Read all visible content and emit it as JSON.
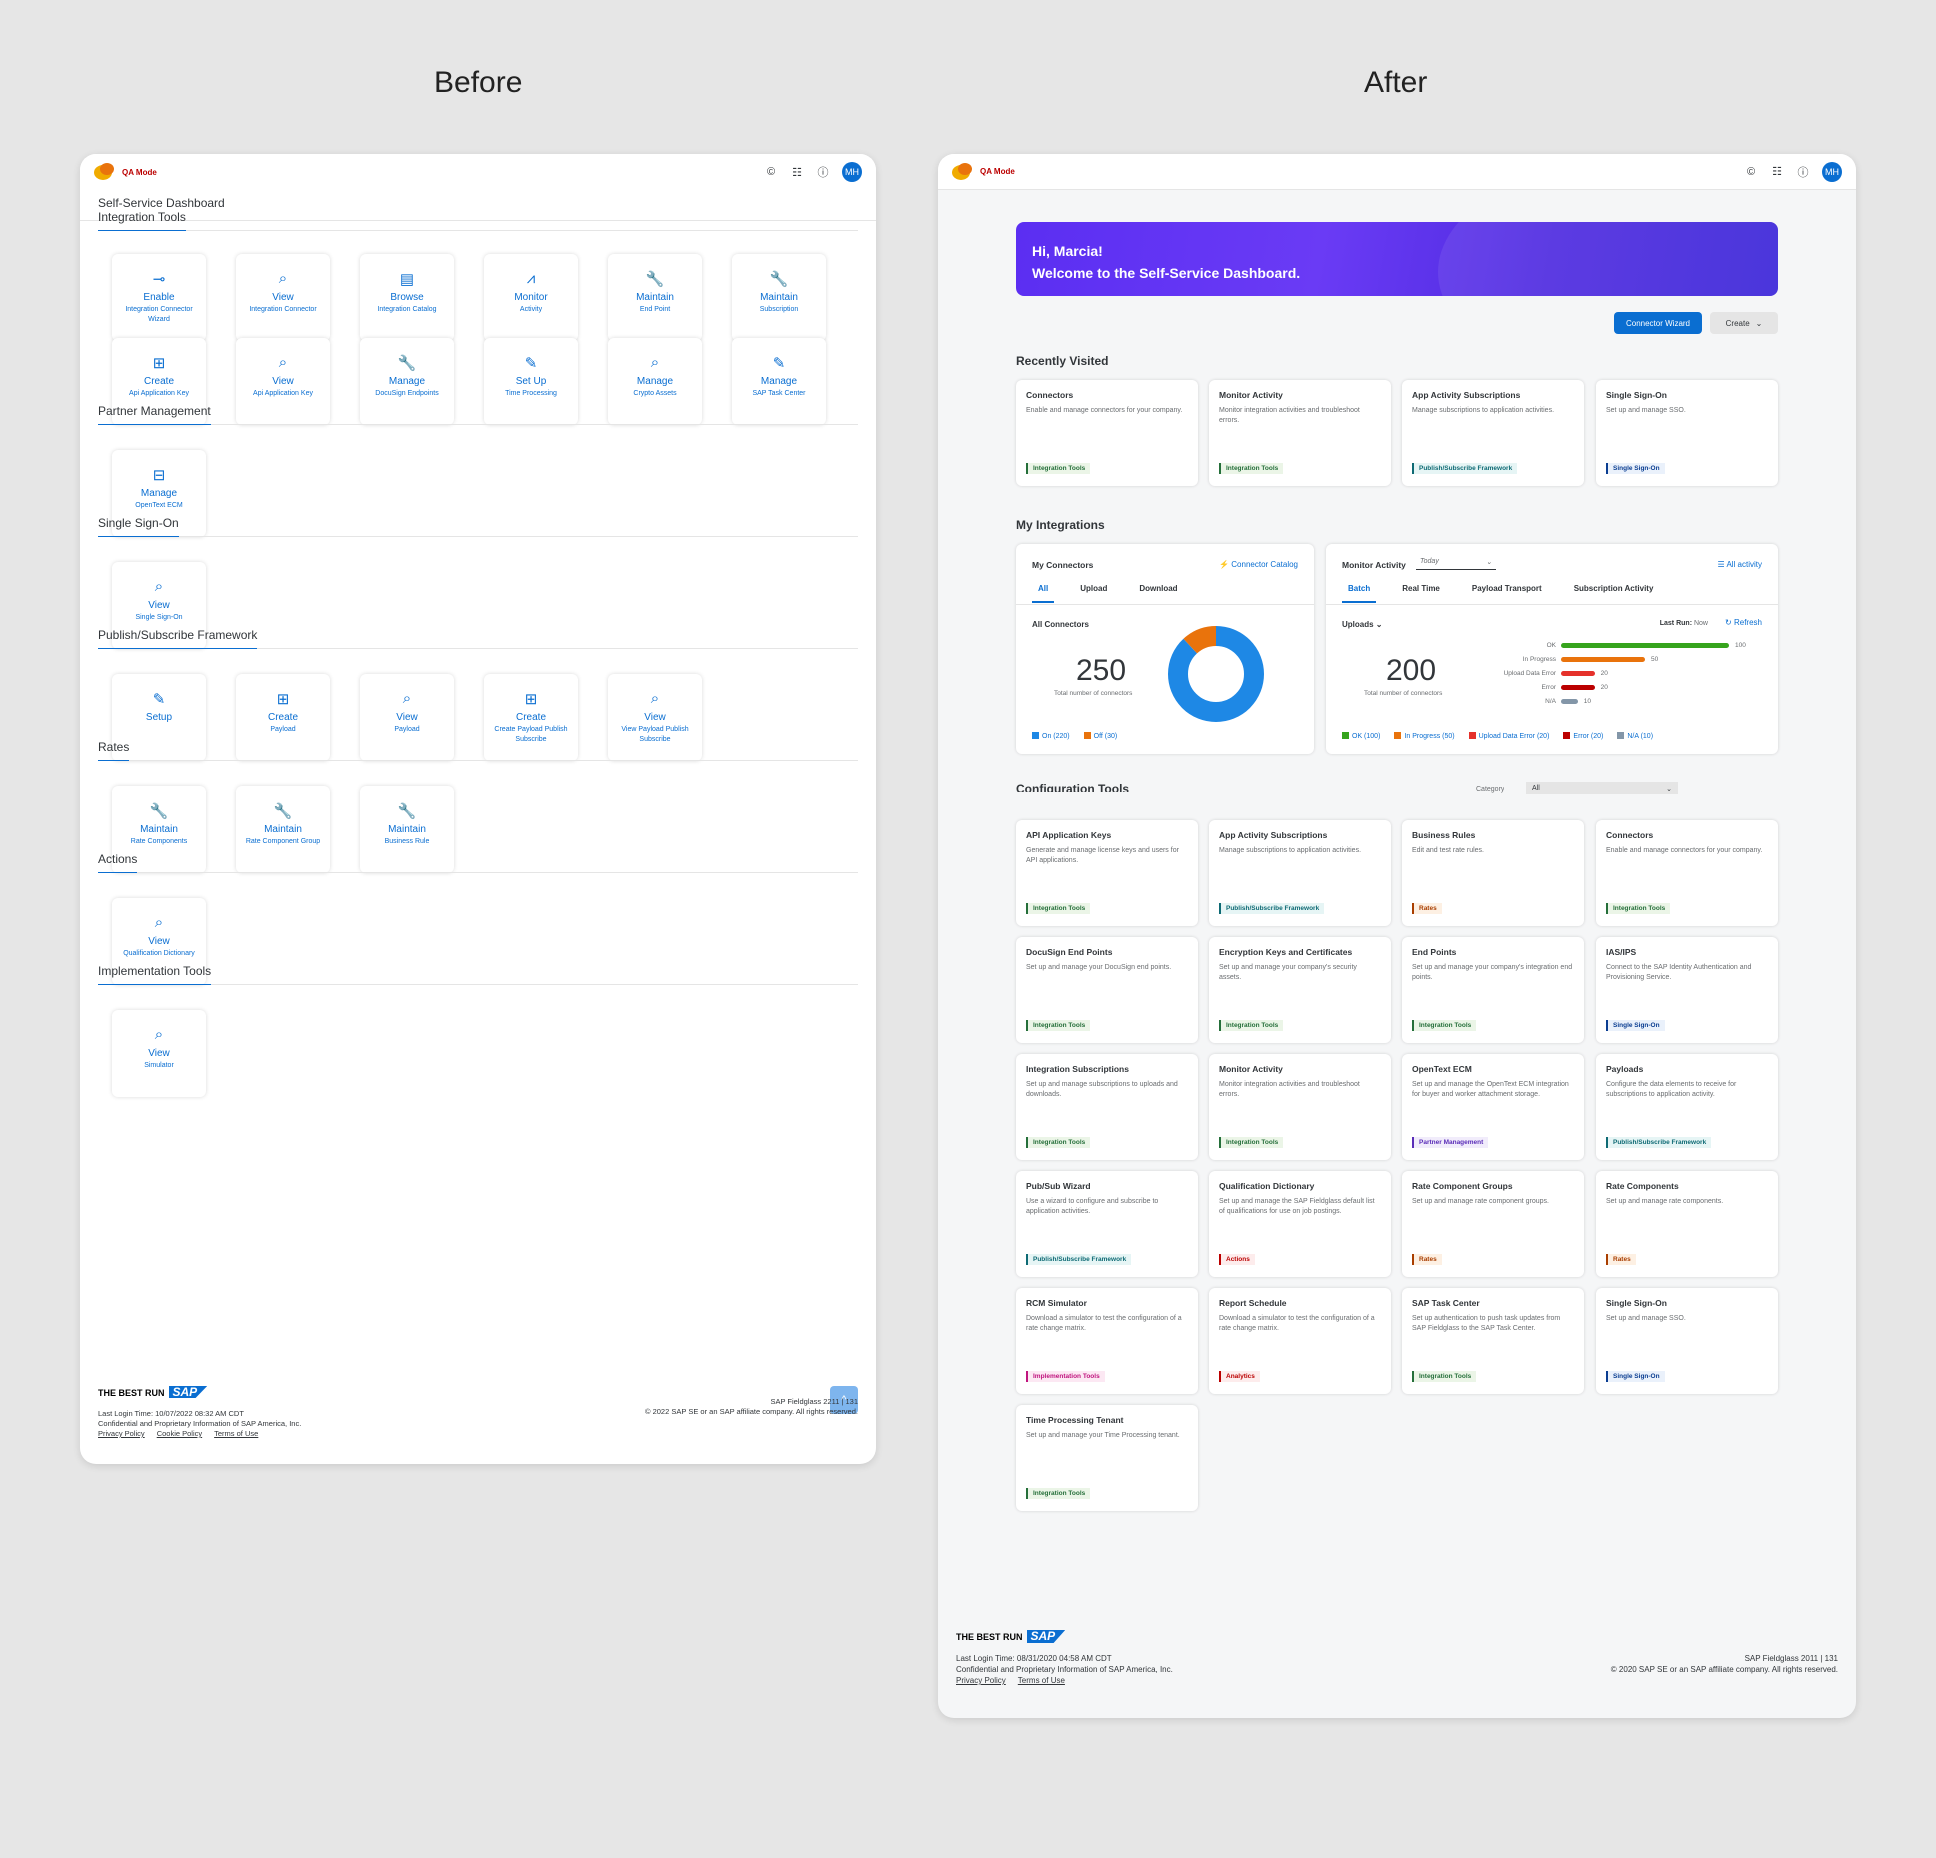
{
  "headings": {
    "before": "Before",
    "after": "After"
  },
  "topbar": {
    "mode": "QA Mode",
    "avatar": "MH"
  },
  "before": {
    "title": "Self-Service Dashboard",
    "sections": [
      {
        "title": "Integration Tools",
        "tiles": [
          {
            "icon": "toggle-icon",
            "title": "Enable",
            "sub": "Integration Connector Wizard"
          },
          {
            "icon": "search-icon",
            "title": "View",
            "sub": "Integration Connector"
          },
          {
            "icon": "catalog-icon",
            "title": "Browse",
            "sub": "Integration Catalog"
          },
          {
            "icon": "activity-icon",
            "title": "Monitor",
            "sub": "Activity"
          },
          {
            "icon": "wrench-icon",
            "title": "Maintain",
            "sub": "End Point"
          },
          {
            "icon": "wrench-icon",
            "title": "Maintain",
            "sub": "Subscription"
          },
          {
            "icon": "create-icon",
            "title": "Create",
            "sub": "Api Application Key"
          },
          {
            "icon": "search-icon",
            "title": "View",
            "sub": "Api Application Key"
          },
          {
            "icon": "wrench-icon",
            "title": "Manage",
            "sub": "DocuSign Endpoints"
          },
          {
            "icon": "pencil-icon",
            "title": "Set Up",
            "sub": "Time Processing"
          },
          {
            "icon": "search-icon",
            "title": "Manage",
            "sub": "Crypto Assets"
          },
          {
            "icon": "pencil-icon",
            "title": "Manage",
            "sub": "SAP Task Center"
          }
        ]
      },
      {
        "title": "Partner Management",
        "tiles": [
          {
            "icon": "hierarchy-icon",
            "title": "Manage",
            "sub": "OpenText ECM"
          }
        ]
      },
      {
        "title": "Single Sign-On",
        "tiles": [
          {
            "icon": "search-icon",
            "title": "View",
            "sub": "Single Sign-On"
          }
        ]
      },
      {
        "title": "Publish/Subscribe Framework",
        "tiles": [
          {
            "icon": "pencil-icon",
            "title": "Setup",
            "sub": ""
          },
          {
            "icon": "create-icon",
            "title": "Create",
            "sub": "Payload"
          },
          {
            "icon": "search-icon",
            "title": "View",
            "sub": "Payload"
          },
          {
            "icon": "create-icon",
            "title": "Create",
            "sub": "Create Payload Publish Subscribe"
          },
          {
            "icon": "search-icon",
            "title": "View",
            "sub": "View Payload Publish Subscribe"
          }
        ]
      },
      {
        "title": "Rates",
        "tiles": [
          {
            "icon": "wrench-icon",
            "title": "Maintain",
            "sub": "Rate Components"
          },
          {
            "icon": "wrench-icon",
            "title": "Maintain",
            "sub": "Rate Component Group"
          },
          {
            "icon": "wrench-icon",
            "title": "Maintain",
            "sub": "Business Rule"
          }
        ]
      },
      {
        "title": "Actions",
        "tiles": [
          {
            "icon": "search-icon",
            "title": "View",
            "sub": "Qualification Dictionary"
          }
        ]
      },
      {
        "title": "Implementation Tools",
        "tiles": [
          {
            "icon": "search-icon",
            "title": "View",
            "sub": "Simulator"
          }
        ]
      }
    ],
    "footer": {
      "bestrun": "THE BEST RUN",
      "sap": "SAP",
      "login": "Last Login Time: 10/07/2022 08:32 AM CDT",
      "conf": "Confidential and Proprietary Information of SAP America, Inc.",
      "links": [
        "Privacy Policy",
        "Cookie Policy",
        "Terms of Use"
      ],
      "version": "SAP Fieldglass 2211 | 131",
      "copy": "© 2022 SAP SE or an SAP affiliate company. All rights reserved."
    }
  },
  "after": {
    "banner": {
      "line1": "Hi, Marcia!",
      "line2": "Welcome to the Self-Service Dashboard."
    },
    "buttons": {
      "wizard": "Connector Wizard",
      "create": "Create"
    },
    "recent_title": "Recently Visited",
    "recent": [
      {
        "title": "Connectors",
        "desc": "Enable and manage connectors for your company.",
        "tag": "Integration Tools",
        "c": "g"
      },
      {
        "title": "Monitor Activity",
        "desc": "Monitor integration activities and troubleshoot errors.",
        "tag": "Integration Tools",
        "c": "g"
      },
      {
        "title": "App Activity Subscriptions",
        "desc": "Manage subscriptions to application activities.",
        "tag": "Publish/Subscribe Framework",
        "c": "t"
      },
      {
        "title": "Single Sign-On",
        "desc": "Set up and manage SSO.",
        "tag": "Single Sign-On",
        "c": "b"
      }
    ],
    "integrations_title": "My Integrations",
    "connectors": {
      "title": "My Connectors",
      "catalog": "Connector Catalog",
      "tabs": [
        "All",
        "Upload",
        "Download"
      ],
      "sub": "All Connectors",
      "total": "250",
      "total_label": "Total number of connectors",
      "legend": [
        "On (220)",
        "Off (30)"
      ],
      "on": 220,
      "off": 30
    },
    "monitor": {
      "title": "Monitor Activity",
      "period": "Today",
      "all": "All activity",
      "tabs": [
        "Batch",
        "Real Time",
        "Payload Transport",
        "Subscription Activity"
      ],
      "uploads": "Uploads",
      "lastrun_label": "Last Run:",
      "lastrun": "Now",
      "refresh": "Refresh",
      "total": "200",
      "total_label": "Total number of connectors",
      "bars": [
        {
          "label": "OK",
          "value": 100,
          "color": "#36a41d"
        },
        {
          "label": "In Progress",
          "value": 50,
          "color": "#e9730c"
        },
        {
          "label": "Upload Data Error",
          "value": 20,
          "color": "#e5312b"
        },
        {
          "label": "Error",
          "value": 20,
          "color": "#bb0000"
        },
        {
          "label": "N/A",
          "value": 10,
          "color": "#8396a8"
        }
      ],
      "legend": [
        "OK (100)",
        "In Progress (50)",
        "Upload Data Error (20)",
        "Error (20)",
        "N/A (10)"
      ]
    },
    "config_title": "Configuration Tools",
    "category_label": "Category",
    "category_value": "All",
    "config": [
      {
        "title": "API Application Keys",
        "desc": "Generate and manage license keys and users for API applications.",
        "tag": "Integration Tools",
        "c": "g"
      },
      {
        "title": "App Activity Subscriptions",
        "desc": "Manage subscriptions to application activities.",
        "tag": "Publish/Subscribe Framework",
        "c": "t"
      },
      {
        "title": "Business Rules",
        "desc": "Edit and test rate rules.",
        "tag": "Rates",
        "c": "o"
      },
      {
        "title": "Connectors",
        "desc": "Enable and manage connectors for your company.",
        "tag": "Integration Tools",
        "c": "g"
      },
      {
        "title": "DocuSign End Points",
        "desc": "Set up and manage your DocuSign end points.",
        "tag": "Integration Tools",
        "c": "g"
      },
      {
        "title": "Encryption Keys and Certificates",
        "desc": "Set up and manage your company's security assets.",
        "tag": "Integration Tools",
        "c": "g"
      },
      {
        "title": "End Points",
        "desc": "Set up and manage your company's integration end points.",
        "tag": "Integration Tools",
        "c": "g"
      },
      {
        "title": "IAS/IPS",
        "desc": "Connect to the SAP Identity Authentication and Provisioning Service.",
        "tag": "Single Sign-On",
        "c": "b"
      },
      {
        "title": "Integration Subscriptions",
        "desc": "Set up and manage subscriptions to uploads and downloads.",
        "tag": "Integration Tools",
        "c": "g"
      },
      {
        "title": "Monitor Activity",
        "desc": "Monitor integration activities and troubleshoot errors.",
        "tag": "Integration Tools",
        "c": "g"
      },
      {
        "title": "OpenText ECM",
        "desc": "Set up and manage the OpenText ECM integration for buyer and worker attachment storage.",
        "tag": "Partner Management",
        "c": "p"
      },
      {
        "title": "Payloads",
        "desc": "Configure the data elements to receive for subscriptions to application activity.",
        "tag": "Publish/Subscribe Framework",
        "c": "t"
      },
      {
        "title": "Pub/Sub Wizard",
        "desc": "Use a wizard to configure and subscribe to application activities.",
        "tag": "Publish/Subscribe Framework",
        "c": "t"
      },
      {
        "title": "Qualification Dictionary",
        "desc": "Set up and manage the SAP Fieldglass default list of qualifications for use on job postings.",
        "tag": "Actions",
        "c": "r"
      },
      {
        "title": "Rate Component Groups",
        "desc": "Set up and manage rate component groups.",
        "tag": "Rates",
        "c": "o"
      },
      {
        "title": "Rate Components",
        "desc": "Set up and manage rate components.",
        "tag": "Rates",
        "c": "o"
      },
      {
        "title": "RCM Simulator",
        "desc": "Download a simulator to test the configuration of a rate change matrix.",
        "tag": "Implementation Tools",
        "c": "m"
      },
      {
        "title": "Report Schedule",
        "desc": "Download a simulator to test the configuration of a rate change matrix.",
        "tag": "Analytics",
        "c": "r"
      },
      {
        "title": "SAP Task Center",
        "desc": "Set up authentication to push task updates from SAP Fieldglass to the SAP Task Center.",
        "tag": "Integration Tools",
        "c": "g"
      },
      {
        "title": "Single Sign-On",
        "desc": "Set up and manage SSO.",
        "tag": "Single Sign-On",
        "c": "b"
      },
      {
        "title": "Time Processing Tenant",
        "desc": "Set up and manage your Time Processing tenant.",
        "tag": "Integration Tools",
        "c": "g"
      }
    ],
    "footer": {
      "bestrun": "THE BEST RUN",
      "sap": "SAP",
      "login": "Last Login Time: 08/31/2020 04:58 AM CDT",
      "conf": "Confidential and Proprietary Information of SAP America, Inc.",
      "links": [
        "Privacy Policy",
        "Terms of Use"
      ],
      "version": "SAP Fieldglass 2011 | 131",
      "copy": "© 2020 SAP SE or an SAP affiliate company. All rights reserved."
    }
  },
  "colors": {
    "accent": "#0a6ed1",
    "tags": {
      "g": [
        "#256f3a",
        "#ebf5e7"
      ],
      "t": [
        "#0e6a74",
        "#e6f5f5"
      ],
      "b": [
        "#0a3d91",
        "#eaf1fb"
      ],
      "o": [
        "#a93e00",
        "#fdf0e3"
      ],
      "p": [
        "#5a2db8",
        "#f1ecfb"
      ],
      "r": [
        "#bb0000",
        "#fdecec"
      ],
      "m": [
        "#c0147e",
        "#fce8f3"
      ]
    }
  }
}
